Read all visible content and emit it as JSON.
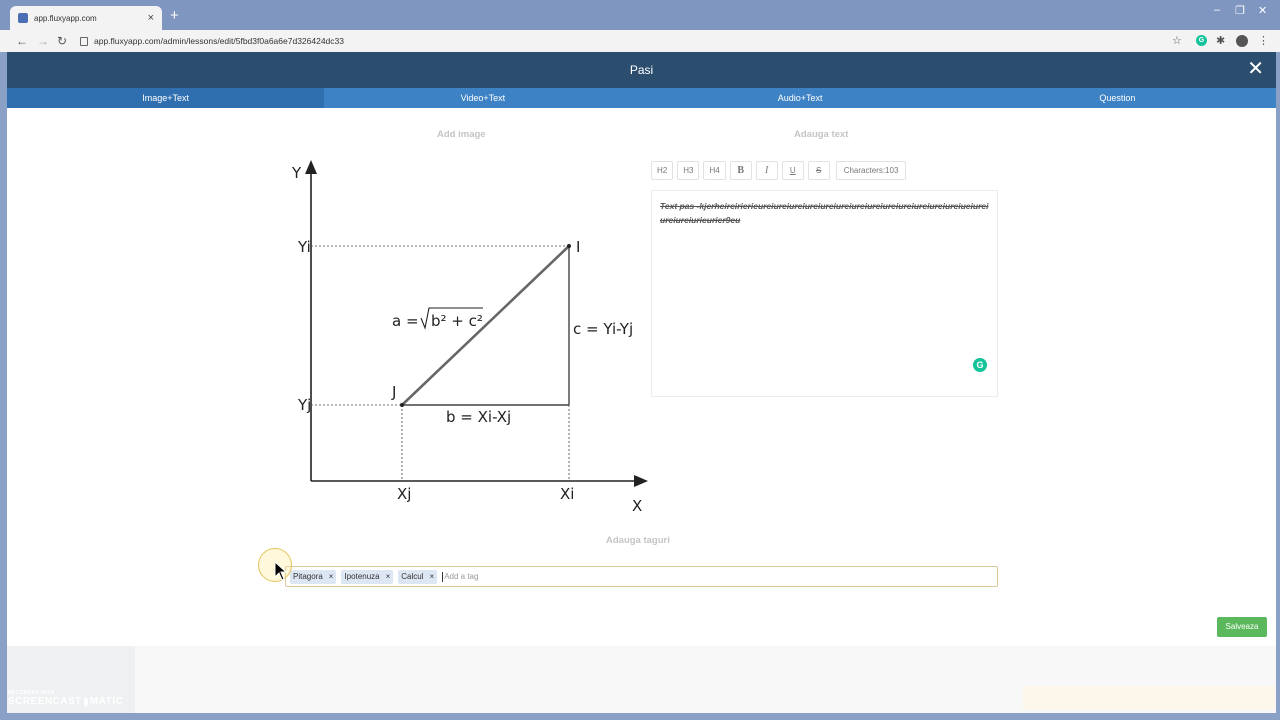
{
  "browser": {
    "tab_title": "app.fluxyapp.com",
    "tab_close": "×",
    "new_tab": "+",
    "url": "app.fluxyapp.com/admin/lessons/edit/5fbd3f0a6a6e7d326424dc33",
    "window_controls": [
      "–",
      "❐",
      "✕"
    ]
  },
  "modal": {
    "title": "Pasi",
    "close": "✕",
    "tabs": [
      {
        "label": "Image+Text",
        "active": true
      },
      {
        "label": "Video+Text",
        "active": false
      },
      {
        "label": "Audio+Text",
        "active": false
      },
      {
        "label": "Question",
        "active": false
      }
    ],
    "add_image_label": "Add image",
    "add_text_label": "Adauga text",
    "add_tags_label": "Adauga taguri",
    "save_label": "Salveaza"
  },
  "diagram": {
    "y_axis": "Y",
    "x_axis": "X",
    "yi": "Yi",
    "yj": "Yj",
    "xj": "Xj",
    "xi": "Xi",
    "point_i": "I",
    "point_j": "J",
    "formula_a_prefix": "a =",
    "formula_a_radicand": "b² + c²",
    "formula_b": "b = Xi-Xj",
    "formula_c": "c = Yi-Yj"
  },
  "editor": {
    "buttons": [
      "H2",
      "H3",
      "H4",
      "B",
      "I",
      "U",
      "S"
    ],
    "characters": "Characters:103",
    "content": "Text pas -kjerheireirierieureiureiureiureiureiureiureiureiureiureiureiureiureiueiureiureiureiurieurier9eu",
    "grammarly": "G"
  },
  "tags": {
    "items": [
      {
        "label": "Pitagora",
        "remove": "×"
      },
      {
        "label": "Ipotenuza",
        "remove": "×"
      },
      {
        "label": "Calcul",
        "remove": "×"
      }
    ],
    "placeholder": "Add a tag"
  },
  "watermark": {
    "line1": "RECORDED WITH",
    "line2a": "SCREENCAST",
    "line2b": "MATIC"
  },
  "colors": {
    "header": "#2b4e6f",
    "tabs": "#3d82c4",
    "save": "#5cb85c",
    "grammarly": "#15c39a"
  }
}
